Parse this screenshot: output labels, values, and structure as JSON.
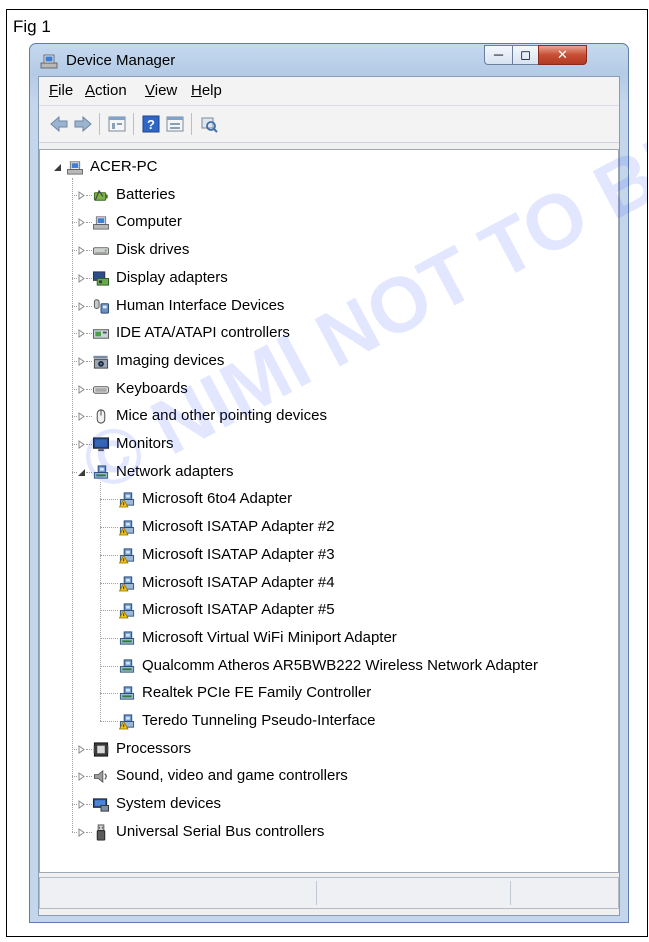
{
  "figure": {
    "label": "Fig 1",
    "watermark": "© NIMI NOT TO BE REPUBLISHED"
  },
  "window": {
    "title": "Device Manager"
  },
  "menu": [
    {
      "label": "File",
      "access_key": "F",
      "rest": "ile"
    },
    {
      "label": "Action",
      "access_key": "A",
      "rest": "ction"
    },
    {
      "label": "View",
      "access_key": "V",
      "rest": "iew"
    },
    {
      "label": "Help",
      "access_key": "H",
      "rest": "elp"
    }
  ],
  "toolbar": [
    "back-icon",
    "forward-icon",
    "properties-icon",
    "help-icon",
    "update-driver-icon",
    "scan-hardware-icon"
  ],
  "tree": {
    "root": {
      "label": "ACER-PC",
      "icon": "computer-icon",
      "expanded": true
    },
    "categories": [
      {
        "label": "Batteries",
        "icon": "battery-icon",
        "expanded": false
      },
      {
        "label": "Computer",
        "icon": "computer-icon",
        "expanded": false
      },
      {
        "label": "Disk drives",
        "icon": "disk-drive-icon",
        "expanded": false
      },
      {
        "label": "Display adapters",
        "icon": "display-adapter-icon",
        "expanded": false
      },
      {
        "label": "Human Interface Devices",
        "icon": "hid-icon",
        "expanded": false
      },
      {
        "label": "IDE ATA/ATAPI controllers",
        "icon": "ide-controller-icon",
        "expanded": false
      },
      {
        "label": "Imaging devices",
        "icon": "camera-icon",
        "expanded": false
      },
      {
        "label": "Keyboards",
        "icon": "keyboard-icon",
        "expanded": false
      },
      {
        "label": "Mice and other pointing devices",
        "icon": "mouse-icon",
        "expanded": false
      },
      {
        "label": "Monitors",
        "icon": "monitor-icon",
        "expanded": false
      },
      {
        "label": "Network adapters",
        "icon": "network-adapter-icon",
        "expanded": true,
        "children": [
          {
            "label": "Microsoft 6to4 Adapter",
            "icon": "network-adapter-warning-icon"
          },
          {
            "label": "Microsoft ISATAP Adapter #2",
            "icon": "network-adapter-warning-icon"
          },
          {
            "label": "Microsoft ISATAP Adapter #3",
            "icon": "network-adapter-warning-icon"
          },
          {
            "label": "Microsoft ISATAP Adapter #4",
            "icon": "network-adapter-warning-icon"
          },
          {
            "label": "Microsoft ISATAP Adapter #5",
            "icon": "network-adapter-warning-icon"
          },
          {
            "label": "Microsoft Virtual WiFi Miniport Adapter",
            "icon": "network-adapter-icon"
          },
          {
            "label": "Qualcomm Atheros AR5BWB222 Wireless Network Adapter",
            "icon": "network-adapter-icon"
          },
          {
            "label": "Realtek PCIe FE Family Controller",
            "icon": "network-adapter-icon"
          },
          {
            "label": "Teredo Tunneling Pseudo-Interface",
            "icon": "network-adapter-warning-icon"
          }
        ]
      },
      {
        "label": "Processors",
        "icon": "processor-icon",
        "expanded": false
      },
      {
        "label": "Sound, video and game controllers",
        "icon": "sound-icon",
        "expanded": false
      },
      {
        "label": "System devices",
        "icon": "system-device-icon",
        "expanded": false
      },
      {
        "label": "Universal Serial Bus controllers",
        "icon": "usb-icon",
        "expanded": false
      }
    ]
  },
  "colors": {
    "accent": "#3d6fa8",
    "warning": "#f0c419",
    "close": "#c74e34"
  }
}
